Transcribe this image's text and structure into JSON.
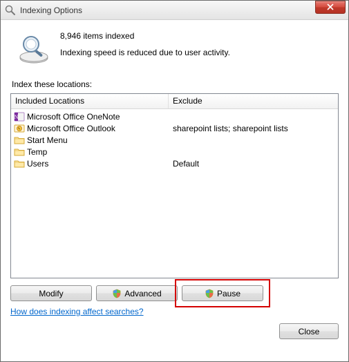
{
  "window": {
    "title": "Indexing Options"
  },
  "status": {
    "count_text": "8,946 items indexed",
    "detail_text": "Indexing speed is reduced due to user activity."
  },
  "locations_label": "Index these locations:",
  "columns": {
    "included": "Included Locations",
    "exclude": "Exclude"
  },
  "rows": [
    {
      "icon": "onenote",
      "included": "Microsoft Office OneNote",
      "exclude": ""
    },
    {
      "icon": "outlook",
      "included": "Microsoft Office Outlook",
      "exclude": "sharepoint lists; sharepoint lists"
    },
    {
      "icon": "folder",
      "included": "Start Menu",
      "exclude": ""
    },
    {
      "icon": "folder",
      "included": "Temp",
      "exclude": ""
    },
    {
      "icon": "folder",
      "included": "Users",
      "exclude": "Default"
    }
  ],
  "buttons": {
    "modify": "Modify",
    "advanced": "Advanced",
    "pause": "Pause",
    "close": "Close"
  },
  "help_link": "How does indexing affect searches?"
}
